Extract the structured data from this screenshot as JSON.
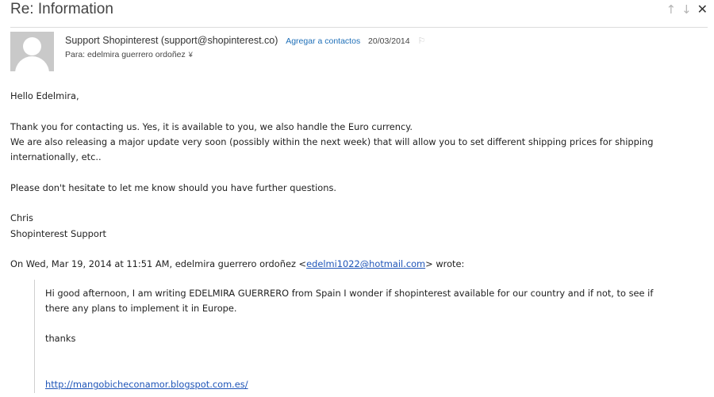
{
  "subject": "Re: Information",
  "nav": {
    "up": "↑",
    "down": "↓",
    "close": "✕"
  },
  "header": {
    "sender": "Support Shopinterest (support@shopinterest.co)",
    "add_contact": "Agregar a contactos",
    "date": "20/03/2014",
    "flag": "⚐",
    "to": "Para: edelmira guerrero ordoñez",
    "to_expand": "¥"
  },
  "body": {
    "greeting": "Hello Edelmira,",
    "para1_line1": "Thank you for contacting us. Yes, it is available to you, we also handle the Euro currency.",
    "para1_line2": "We are also releasing a major update very soon (possibly within the next week)  that will allow you to set different shipping prices for shipping internationally, etc..",
    "para2": "Please don't hesitate to let me know should you have further questions.",
    "sign_name": "Chris",
    "sign_team": "Shopinterest Support",
    "quote_intro_pre": "On Wed, Mar 19, 2014 at 11:51 AM, edelmira guerrero ordoñez <",
    "quote_email": "edelmi1022@hotmail.com",
    "quote_intro_post": "> wrote:"
  },
  "quote": {
    "text": "Hi good afternoon, I am writing EDELMIRA GUERRERO from Spain I wonder if shopinterest available for our country and if not, to see if there any plans to implement it in Europe.",
    "thanks": "thanks",
    "url": "http://mangobicheconamor.blogspot.com.es/"
  },
  "colors": {
    "link": "#1f55b8",
    "accent_link": "#1e6fb8",
    "avatar_bg": "#c9c9c9"
  }
}
